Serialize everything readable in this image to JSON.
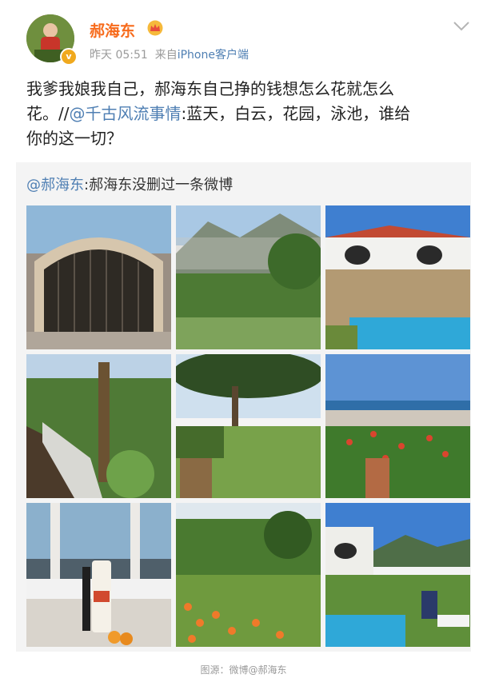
{
  "post": {
    "username": "郝海东",
    "time": "昨天 05:51",
    "source_prefix": "来自",
    "source": "iPhone客户端",
    "text_line1": "我爹我娘我自己，郝海东自己挣的钱想怎么花就怎么",
    "text_line2_plain": "花。//",
    "text_line2_link": "@千古风流事情",
    "text_line2_rest": ":蓝天，白云，花园，泳池，谁给",
    "text_line3": "你的这一切？"
  },
  "repost": {
    "author_link": "@郝海东",
    "text": ":郝海东没删过一条微博"
  },
  "photos": [
    {
      "name": "photo-gate",
      "desc": "arched iron gate"
    },
    {
      "name": "photo-hills",
      "desc": "mountain village garden"
    },
    {
      "name": "photo-villa-pool",
      "desc": "white villa with pool"
    },
    {
      "name": "photo-garden-path",
      "desc": "garden path with pine"
    },
    {
      "name": "photo-lawn-pines",
      "desc": "lawn under pines"
    },
    {
      "name": "photo-sea-view",
      "desc": "sea view with flowers"
    },
    {
      "name": "photo-window",
      "desc": "window with bottles"
    },
    {
      "name": "photo-flower-garden",
      "desc": "flower garden"
    },
    {
      "name": "photo-pool-lounger",
      "desc": "pool with lounger"
    }
  ],
  "footer": {
    "credit": "图源：微博@郝海东"
  },
  "colors": {
    "username": "#f76b1c",
    "link": "#4f7fb3",
    "meta": "#9a9a9a",
    "repost_bg": "#f4f4f4"
  },
  "icons": {
    "verified": "v-badge-icon",
    "crown": "crown-icon",
    "chevron": "chevron-down-icon"
  }
}
